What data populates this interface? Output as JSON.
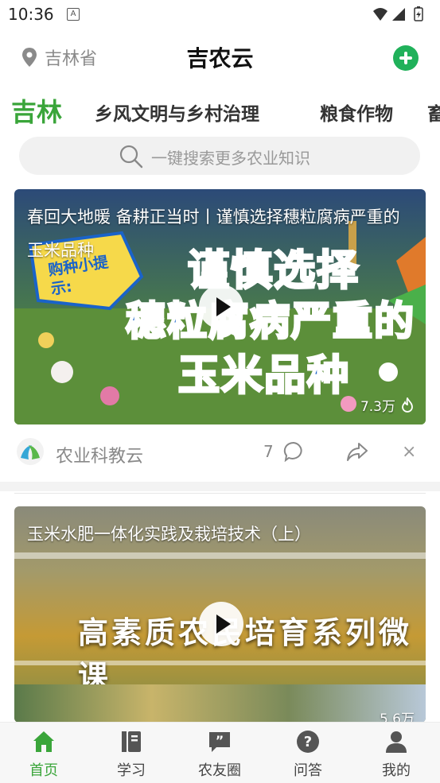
{
  "status_bar": {
    "time": "10:36",
    "notification_glyph": "A"
  },
  "header": {
    "location": "吉林省",
    "title": "吉农云",
    "add_icon": "plus-circle-icon",
    "accent": "#20b15a"
  },
  "tabs": [
    {
      "label": "吉林",
      "active": true
    },
    {
      "label": "乡风文明与乡村治理",
      "active": false
    },
    {
      "label": "粮食作物",
      "active": false
    },
    {
      "label": "畜",
      "active": false
    }
  ],
  "search": {
    "placeholder": "一键搜索更多农业知识"
  },
  "feed": [
    {
      "caption": "春回大地暖 备耕正当时丨谨慎选择穗粒腐病严重的玉米品种",
      "badge_text": "购种小提示:",
      "banner_lines": [
        "谨慎选择",
        "穗粒腐病严重的",
        "玉米品种"
      ],
      "views": "7.3万",
      "source": "农业科教云",
      "comments": "7",
      "close": "×"
    },
    {
      "caption": "玉米水肥一体化实践及栽培技术（上）",
      "overlay_title": "高素质农民培育系列微课",
      "views": "5.6万"
    }
  ],
  "bottom_nav": [
    {
      "label": "首页",
      "icon": "home-icon",
      "active": true
    },
    {
      "label": "学习",
      "icon": "book-icon",
      "active": false
    },
    {
      "label": "农友圈",
      "icon": "quote-bubble-icon",
      "active": false
    },
    {
      "label": "问答",
      "icon": "question-icon",
      "active": false
    },
    {
      "label": "我的",
      "icon": "person-icon",
      "active": false
    }
  ],
  "colors": {
    "active_green": "#3aa53a",
    "brand_blue": "#1a63c9"
  }
}
